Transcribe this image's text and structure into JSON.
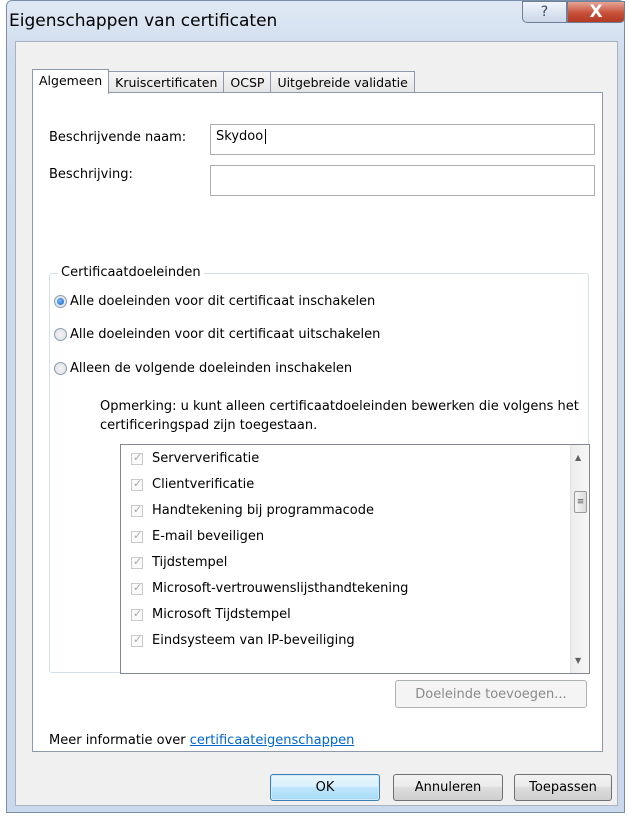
{
  "window": {
    "title": "Eigenschappen van certificaten",
    "help_glyph": "?",
    "close_glyph": "X"
  },
  "tabs": [
    {
      "label": "Algemeen",
      "active": true
    },
    {
      "label": "Kruiscertificaten",
      "active": false
    },
    {
      "label": "OCSP",
      "active": false
    },
    {
      "label": "Uitgebreide validatie",
      "active": false
    }
  ],
  "general": {
    "friendly_name_label": "Beschrijvende naam:",
    "friendly_name_value": "Skydoo",
    "description_label": "Beschrijving:",
    "description_value": ""
  },
  "purposes": {
    "group_title": "Certificaatdoeleinden",
    "options": [
      {
        "label": "Alle doeleinden voor dit certificaat inschakelen",
        "checked": true
      },
      {
        "label": "Alle doeleinden voor dit certificaat uitschakelen",
        "checked": false
      },
      {
        "label": "Alleen de volgende doeleinden inschakelen",
        "checked": false
      }
    ],
    "note": "Opmerking: u kunt alleen certificaatdoeleinden bewerken die volgens het certificeringspad zijn toegestaan.",
    "items": [
      "Serververificatie",
      "Clientverificatie",
      "Handtekening bij programmacode",
      "E-mail beveiligen",
      "Tijdstempel",
      "Microsoft-vertrouwenslijsthandtekening",
      "Microsoft Tijdstempel",
      "Eindsysteem van IP-beveiliging"
    ],
    "add_purpose_button": "Doeleinde toevoegen..."
  },
  "footer": {
    "more_info_prefix": "Meer informatie over ",
    "more_info_link": "certificaateigenschappen"
  },
  "buttons": {
    "ok": "OK",
    "cancel": "Annuleren",
    "apply": "Toepassen"
  }
}
